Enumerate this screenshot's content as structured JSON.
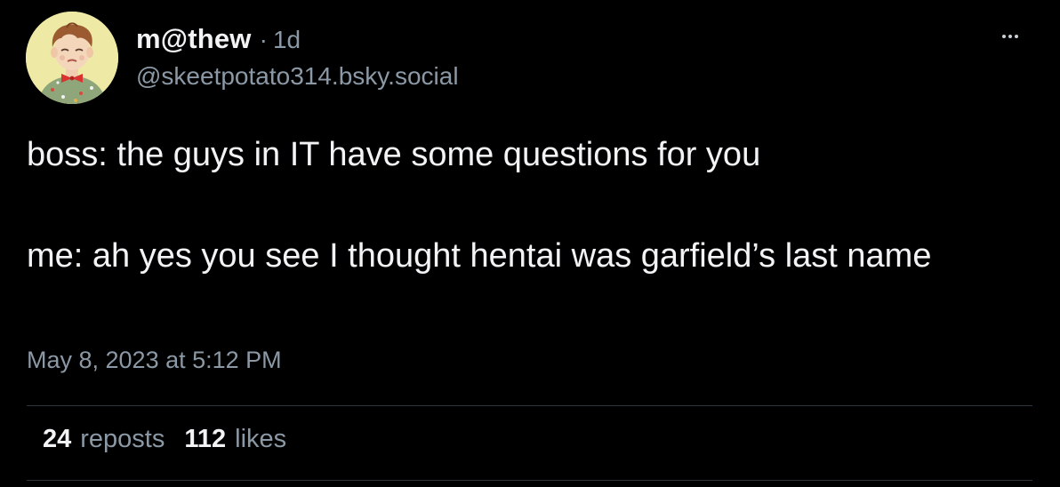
{
  "post": {
    "author": {
      "display_name": "m@thew",
      "handle": "@skeetpotato314.bsky.social",
      "avatar_icon": "cartoon-child-portrait-avatar"
    },
    "separator": "·",
    "time_ago": "1d",
    "more_icon": "ellipsis-icon",
    "text_lines": [
      "boss: the guys in IT have some questions for you",
      "me: ah yes you see I thought hentai was garfield’s last name"
    ],
    "timestamp": "May 8, 2023 at 5:12 PM",
    "stats": {
      "reposts_count": "24",
      "reposts_label": "reposts",
      "likes_count": "112",
      "likes_label": "likes"
    }
  },
  "colors": {
    "background": "#000000",
    "primary_text": "#f1f3f5",
    "secondary_text": "#8b98a5",
    "divider": "#2e3439"
  }
}
